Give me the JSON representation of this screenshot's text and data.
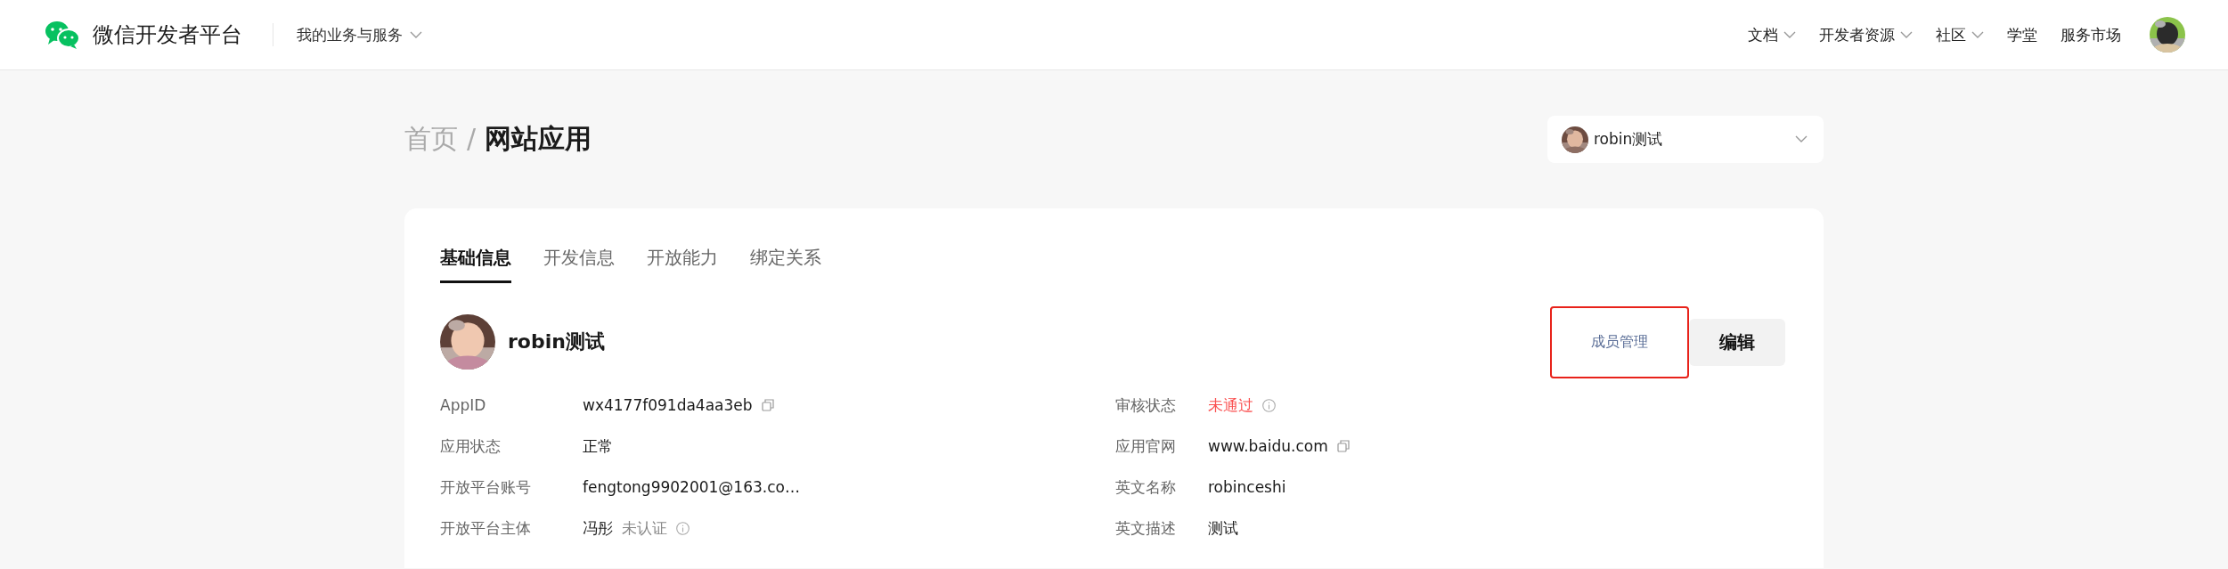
{
  "header": {
    "brand": "微信开发者平台",
    "business_menu": {
      "label": "我的业务与服务"
    },
    "nav": [
      {
        "label": "文档",
        "dropdown": true
      },
      {
        "label": "开发者资源",
        "dropdown": true
      },
      {
        "label": "社区",
        "dropdown": true
      },
      {
        "label": "学堂",
        "dropdown": false
      },
      {
        "label": "服务市场",
        "dropdown": false
      }
    ]
  },
  "breadcrumb": [
    {
      "label": "首页",
      "current": false
    },
    {
      "label": "网站应用",
      "current": true
    }
  ],
  "breadcrumb_separator": "/",
  "account_selector": {
    "name": "robin测试"
  },
  "tabs": [
    {
      "label": "基础信息",
      "selected": true
    },
    {
      "label": "开发信息",
      "selected": false
    },
    {
      "label": "开放能力",
      "selected": false
    },
    {
      "label": "绑定关系",
      "selected": false
    }
  ],
  "app": {
    "name": "robin测试",
    "member_button": "成员管理",
    "edit_button": "编辑"
  },
  "fields_left": [
    {
      "label": "AppID",
      "value": "wx4177f091da4aa3eb",
      "alert": false,
      "copyable": true,
      "info": false
    },
    {
      "label": "应用状态",
      "value": "正常",
      "alert": false,
      "copyable": false,
      "info": false
    },
    {
      "label": "开放平台账号",
      "value": "fengtong9902001@163.co…",
      "alert": false,
      "copyable": false,
      "info": false
    },
    {
      "label": "开放平台主体",
      "value": "冯彤",
      "note": "未认证",
      "alert": false,
      "copyable": false,
      "info": true
    }
  ],
  "fields_right": [
    {
      "label": "审核状态",
      "value": "未通过",
      "alert": true,
      "copyable": false,
      "info": true
    },
    {
      "label": "应用官网",
      "value": "www.baidu.com",
      "alert": false,
      "copyable": true,
      "info": false
    },
    {
      "label": "英文名称",
      "value": "robinceshi",
      "alert": false,
      "copyable": false,
      "info": false
    },
    {
      "label": "英文描述",
      "value": "测试",
      "alert": false,
      "copyable": false,
      "info": false
    }
  ]
}
